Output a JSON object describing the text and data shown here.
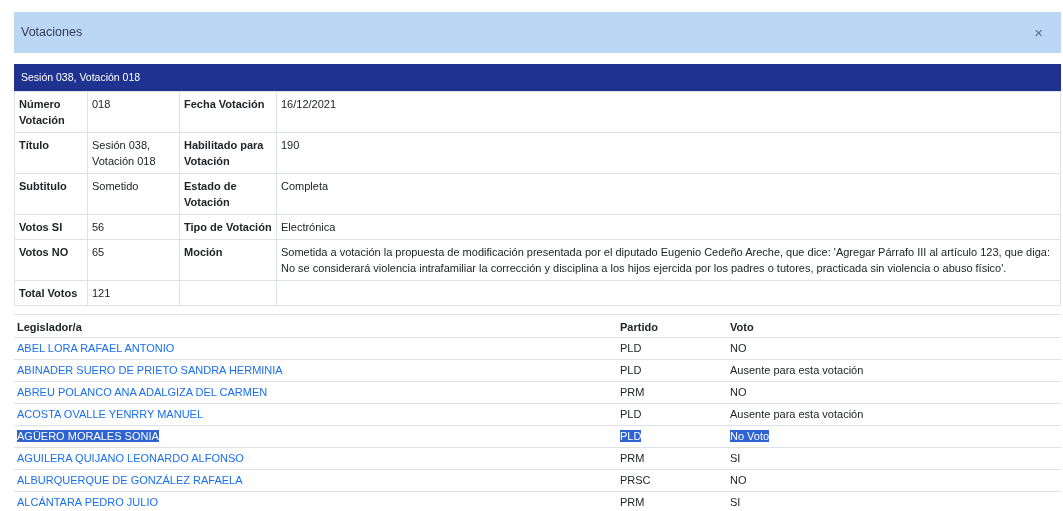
{
  "dialog": {
    "title": "Votaciones",
    "close": "×"
  },
  "panel": {
    "title": "Sesión 038, Votación 018"
  },
  "details": [
    [
      {
        "label": "Número Votación",
        "value": "018"
      },
      {
        "label": "Fecha Votación",
        "value": "16/12/2021"
      }
    ],
    [
      {
        "label": "Título",
        "value": "Sesión 038, Votación 018"
      },
      {
        "label": "Habilitado para Votación",
        "value": "190"
      }
    ],
    [
      {
        "label": "Subtitulo",
        "value": "Sometido"
      },
      {
        "label": "Estado de Votación",
        "value": "Completa"
      }
    ],
    [
      {
        "label": "Votos SI",
        "value": "56"
      },
      {
        "label": "Tipo de Votación",
        "value": "Electrónica"
      }
    ],
    [
      {
        "label": "Votos NO",
        "value": "65"
      },
      {
        "label": "Moción",
        "value": "Sometida a votación la propuesta de modificación presentada por el diputado Eugenio Cedeño Areche, que dice: 'Agregar Párrafo III al artículo 123, que diga: No se considerará violencia intrafamiliar la corrección y disciplina a los hijos ejercida por los padres o tutores, practicada sin violencia o abuso físico'."
      }
    ],
    [
      {
        "label": "Total Votos",
        "value": "121"
      }
    ]
  ],
  "votes": {
    "columns": [
      "Legislador/a",
      "Partido",
      "Voto"
    ],
    "rows": [
      {
        "name": "ABEL LORA RAFAEL ANTONIO",
        "party": "PLD",
        "vote": "NO",
        "selected": false
      },
      {
        "name": "ABINADER SUERO DE PRIETO SANDRA HERMINIA",
        "party": "PLD",
        "vote": "Ausente para esta votación",
        "selected": false
      },
      {
        "name": "ABREU POLANCO ANA ADALGIZA DEL CARMEN",
        "party": "PRM",
        "vote": "NO",
        "selected": false
      },
      {
        "name": "ACOSTA OVALLE YENRRY MANUEL",
        "party": "PLD",
        "vote": "Ausente para esta votación",
        "selected": false
      },
      {
        "name": "AGÜERO MORALES SONIA",
        "party": "PLD",
        "vote": "No Voto",
        "selected": true
      },
      {
        "name": "AGUILERA QUIJANO LEONARDO ALFONSO",
        "party": "PRM",
        "vote": "SI",
        "selected": false
      },
      {
        "name": "ALBURQUERQUE DE GONZÁLEZ RAFAELA",
        "party": "PRSC",
        "vote": "NO",
        "selected": false
      },
      {
        "name": "ALCÁNTARA PEDRO JULIO",
        "party": "PRM",
        "vote": "SI",
        "selected": false
      }
    ]
  }
}
